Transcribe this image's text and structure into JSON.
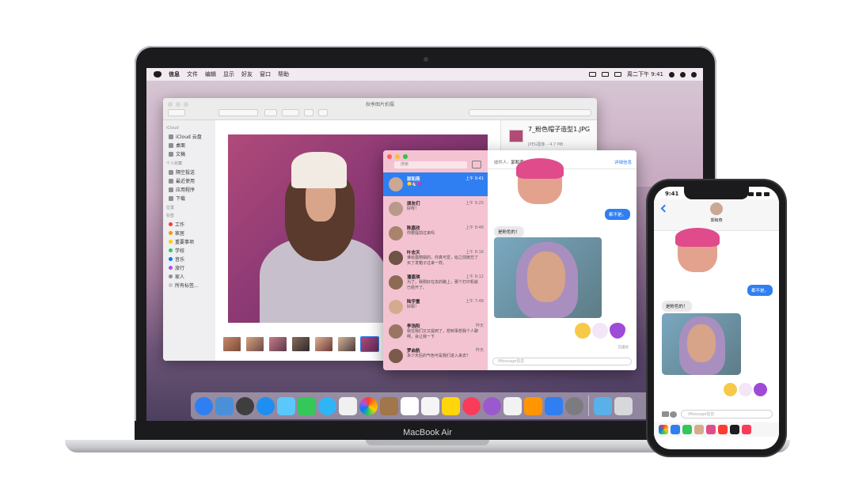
{
  "device_label": "MacBook Air",
  "menubar": {
    "items": [
      "信息",
      "文件",
      "编辑",
      "显示",
      "好友",
      "窗口",
      "帮助"
    ],
    "clock": "周二下午 9:41"
  },
  "finder": {
    "title": "秋季图片拍摄",
    "sidebar": {
      "icloud_head": "iCloud",
      "icloud_items": [
        "iCloud 云盘",
        "桌面",
        "文稿"
      ],
      "personal_head": "个人收藏",
      "personal_items": [
        "隔空投送",
        "最近使用",
        "应用程序",
        "下载"
      ],
      "location_head": "位置",
      "tags_head": "标签",
      "tags": [
        {
          "label": "工作",
          "color": "#ff3b30"
        },
        {
          "label": "家居",
          "color": "#ff9500"
        },
        {
          "label": "重要事项",
          "color": "#ffcc00"
        },
        {
          "label": "学校",
          "color": "#34c759"
        },
        {
          "label": "音乐",
          "color": "#007aff"
        },
        {
          "label": "旅行",
          "color": "#af52de"
        },
        {
          "label": "家人",
          "color": "#8e8e93"
        },
        {
          "label": "所有标签...",
          "color": "#c7c7cc"
        }
      ]
    },
    "info": {
      "filename": "7_粉色帽子造型1.JPG",
      "meta": "JPEG图像 – 4.7 MB"
    }
  },
  "messages_mac": {
    "search_placeholder": "搜索",
    "to_label": "收件人:",
    "to_name": "郭和燕",
    "detail_link": "详细信息",
    "conversations": [
      {
        "name": "郭和燕",
        "time": "上午 9:41",
        "preview": "🙄🦄💜",
        "selected": true
      },
      {
        "name": "朋友们",
        "time": "上午 9:25",
        "preview": "好呀！",
        "selected": false
      },
      {
        "name": "陈嘉欣",
        "time": "上午 8:48",
        "preview": "你要提前过来吗",
        "selected": false
      },
      {
        "name": "叶志天",
        "time": "上午 8:16",
        "preview": "谁给露丽娟的，你真可爱，给之前她忘了买了发箱子过来一样。",
        "selected": false
      },
      {
        "name": "潘嘉琪",
        "time": "上午 8:12",
        "preview": "为了，我刚好在去的路上，那个打印机就已经开了。",
        "selected": false
      },
      {
        "name": "陆宇童",
        "time": "上午 7:48",
        "preview": "好耶！",
        "selected": false
      },
      {
        "name": "李浩阳",
        "time": "昨天",
        "preview": "我在我们又又提到了，想到事想我个人聊啊，会让我一下",
        "selected": false
      },
      {
        "name": "罗启航",
        "time": "昨天",
        "preview": "多少天后的气色可是我们进入来去？",
        "selected": false
      }
    ],
    "bubbles": {
      "sent_1": "都不是。",
      "recv_1": "是粉色的！"
    },
    "status": "已送达",
    "input_placeholder": "iMessage信息"
  },
  "iphone": {
    "time": "9:41",
    "contact_name": "郭和燕",
    "sent_1": "都不是。",
    "recv_1": "是粉色的！",
    "status": "已送达",
    "input_placeholder": "iMessage信息"
  },
  "colors": {
    "imessage_blue": "#2f7ff2",
    "sidebar_pink": "#f4c3d1",
    "bubble_gray": "#e9e9eb"
  }
}
